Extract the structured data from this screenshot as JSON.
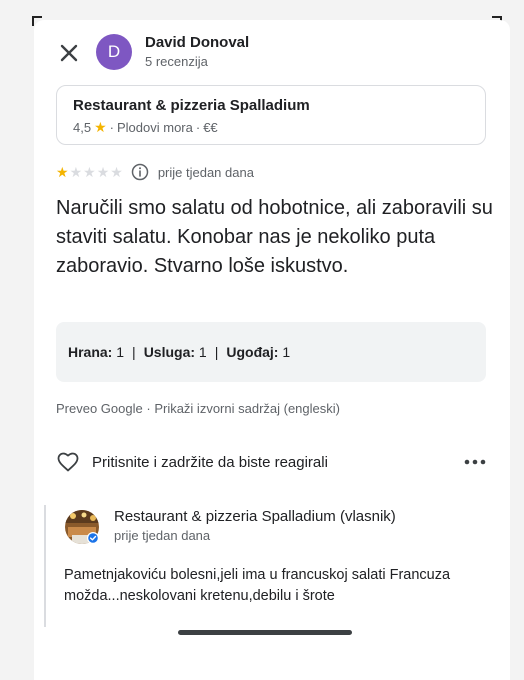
{
  "header": {
    "avatar_initial": "D",
    "reviewer_name": "David Donoval",
    "reviewer_reviews": "5 recenzija"
  },
  "place": {
    "name": "Restaurant & pizzeria Spalladium",
    "rating": "4,5",
    "category": "Plodovi mora",
    "price": "€€"
  },
  "review": {
    "stars_filled": 1,
    "stars_total": 5,
    "time": "prije tjedan dana",
    "text": "Naručili smo salatu od hobotnice, ali zaboravili su staviti salatu. Konobar nas je nekoliko puta zaboravio. Stvarno loše iskustvo.",
    "scores": [
      {
        "label": "Hrana:",
        "value": "1"
      },
      {
        "label": "Usluga:",
        "value": "1"
      },
      {
        "label": "Ugođaj:",
        "value": "1"
      }
    ],
    "translated_by": "Preveo Google",
    "show_original": "Prikaži izvorni sadržaj (engleski)"
  },
  "react": {
    "prompt": "Pritisnite i zadržite da biste reagirali"
  },
  "owner_reply": {
    "name": "Restaurant & pizzeria Spalladium (vlasnik)",
    "time": "prije tjedan dana",
    "text": "Pametnjakoviću bolesni,jeli ima u francuskoj salati Francuza možda...neskolovani kretenu,debilu i šrote"
  },
  "colors": {
    "avatar": "#7e57c2",
    "star": "#f4b400",
    "verified": "#1a73e8"
  }
}
